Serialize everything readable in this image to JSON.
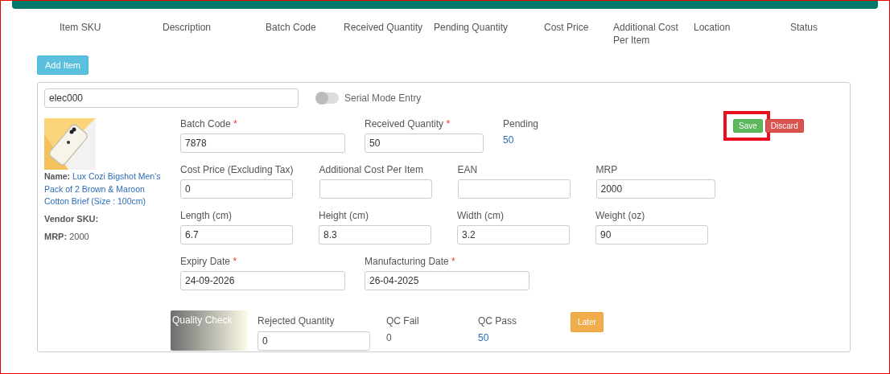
{
  "header": {
    "columns": [
      "Item SKU",
      "Description",
      "Batch Code",
      "Received Quantity",
      "Pending Quantity",
      "Cost Price",
      "Additional Cost Per Item",
      "Location",
      "Status"
    ]
  },
  "add_item_button": "Add Item",
  "item": {
    "sku": "elec000",
    "serial_mode": {
      "label": "Serial Mode Entry",
      "on": false
    },
    "product": {
      "name_label": "Name:",
      "name": "Lux Cozi Bigshot Men's Pack of 2 Brown & Maroon Cotton Brief (Size : 100cm)",
      "vendor_sku_label": "Vendor SKU:",
      "mrp_label": "MRP:",
      "mrp": "2000"
    },
    "pending": {
      "label": "Pending",
      "value": "50"
    },
    "actions": [
      {
        "label": "Save",
        "kind": "save",
        "highlighted": true
      },
      {
        "label": "Discard",
        "kind": "discard",
        "highlighted": false
      }
    ],
    "rows": [
      [
        {
          "label": "Batch Code",
          "value": "7878",
          "required_mark": "*"
        },
        {
          "label": "Received Quantity",
          "value": "50",
          "required_mark": "*"
        }
      ],
      [
        {
          "label": "Cost Price (Excluding Tax)",
          "value": "0"
        },
        {
          "label": "Additional Cost Per Item"
        },
        {
          "label": "EAN"
        },
        {
          "label": "MRP",
          "value": "2000"
        }
      ],
      [
        {
          "label": "Length (cm)",
          "value": "6.7"
        },
        {
          "label": "Height (cm)",
          "value": "8.3"
        },
        {
          "label": "Width (cm)",
          "value": "3.2"
        },
        {
          "label": "Weight (oz)",
          "value": "90"
        }
      ],
      [
        {
          "label": "Expiry Date",
          "value": "24-09-2026",
          "required_mark": "*"
        },
        {
          "label": "Manufacturing Date",
          "value": "26-04-2025",
          "required_mark": "*"
        }
      ]
    ],
    "quality_check": {
      "title": "Quality Check",
      "rejected": {
        "label": "Rejected Quantity",
        "value": "0"
      },
      "qc_fail": {
        "label": "QC Fail",
        "value": "0"
      },
      "qc_pass": {
        "label": "QC Pass",
        "value": "50"
      },
      "later_button": "Later"
    }
  }
}
